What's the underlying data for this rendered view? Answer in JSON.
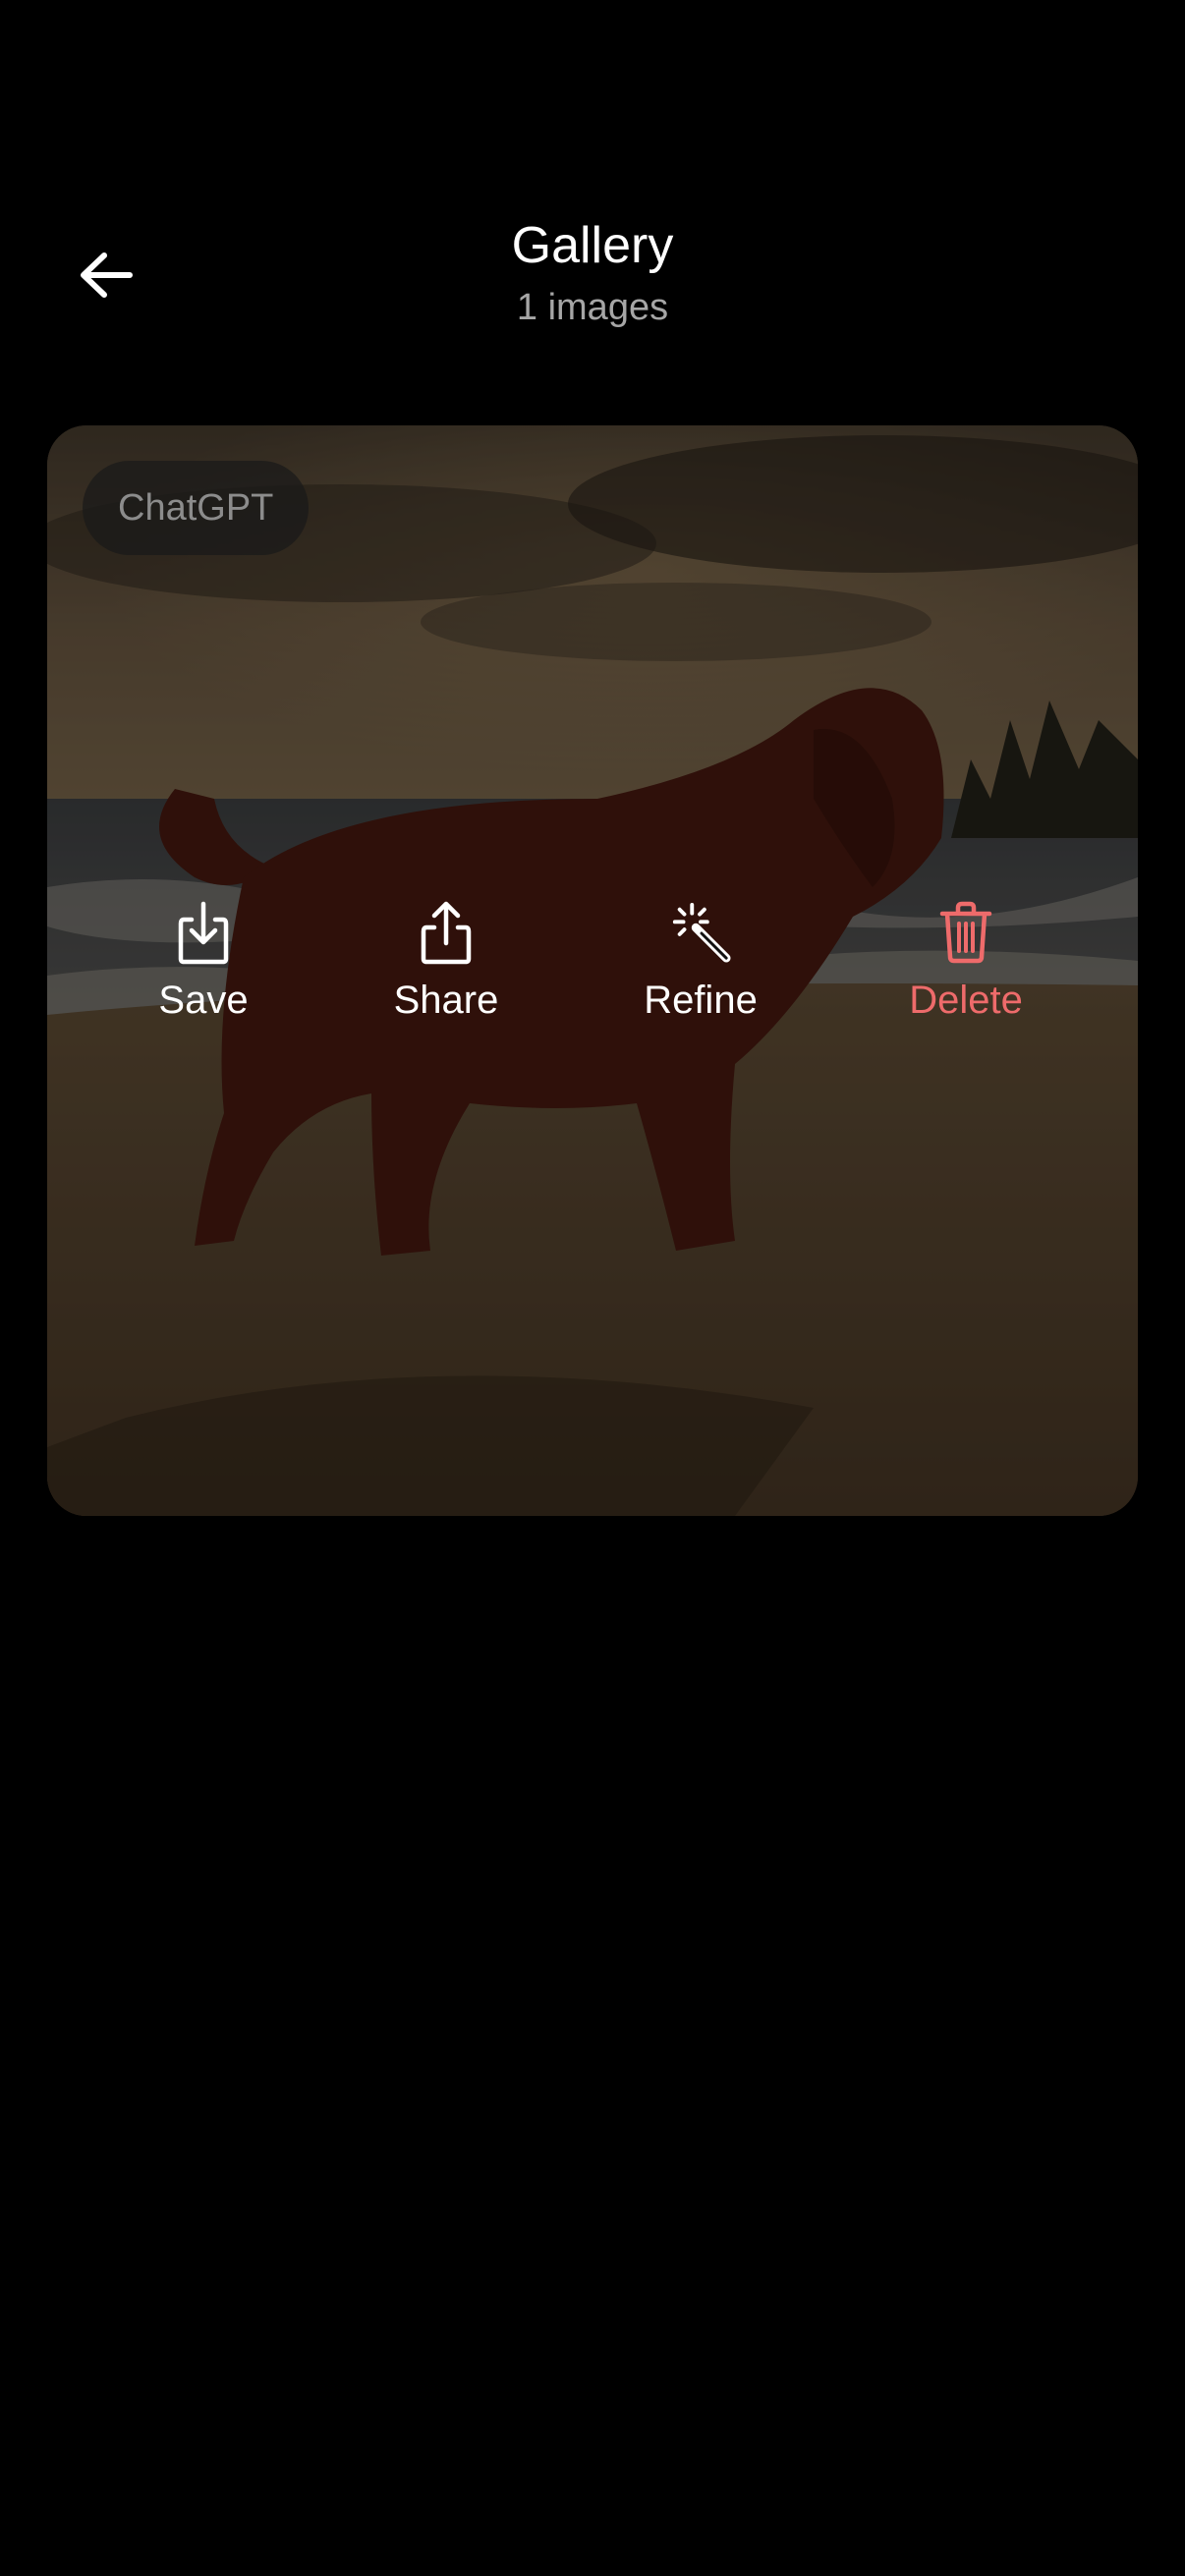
{
  "header": {
    "back_icon": "arrow-left-icon",
    "title": "Gallery",
    "subtitle": "1 images"
  },
  "gallery": {
    "items": [
      {
        "source_label": "ChatGPT",
        "actions": [
          {
            "label": "Save",
            "icon": "download-icon"
          },
          {
            "label": "Share",
            "icon": "share-icon"
          },
          {
            "label": "Refine",
            "icon": "magic-wand-icon"
          },
          {
            "label": "Delete",
            "icon": "trash-icon",
            "color": "#ee6b6b"
          }
        ]
      }
    ]
  }
}
